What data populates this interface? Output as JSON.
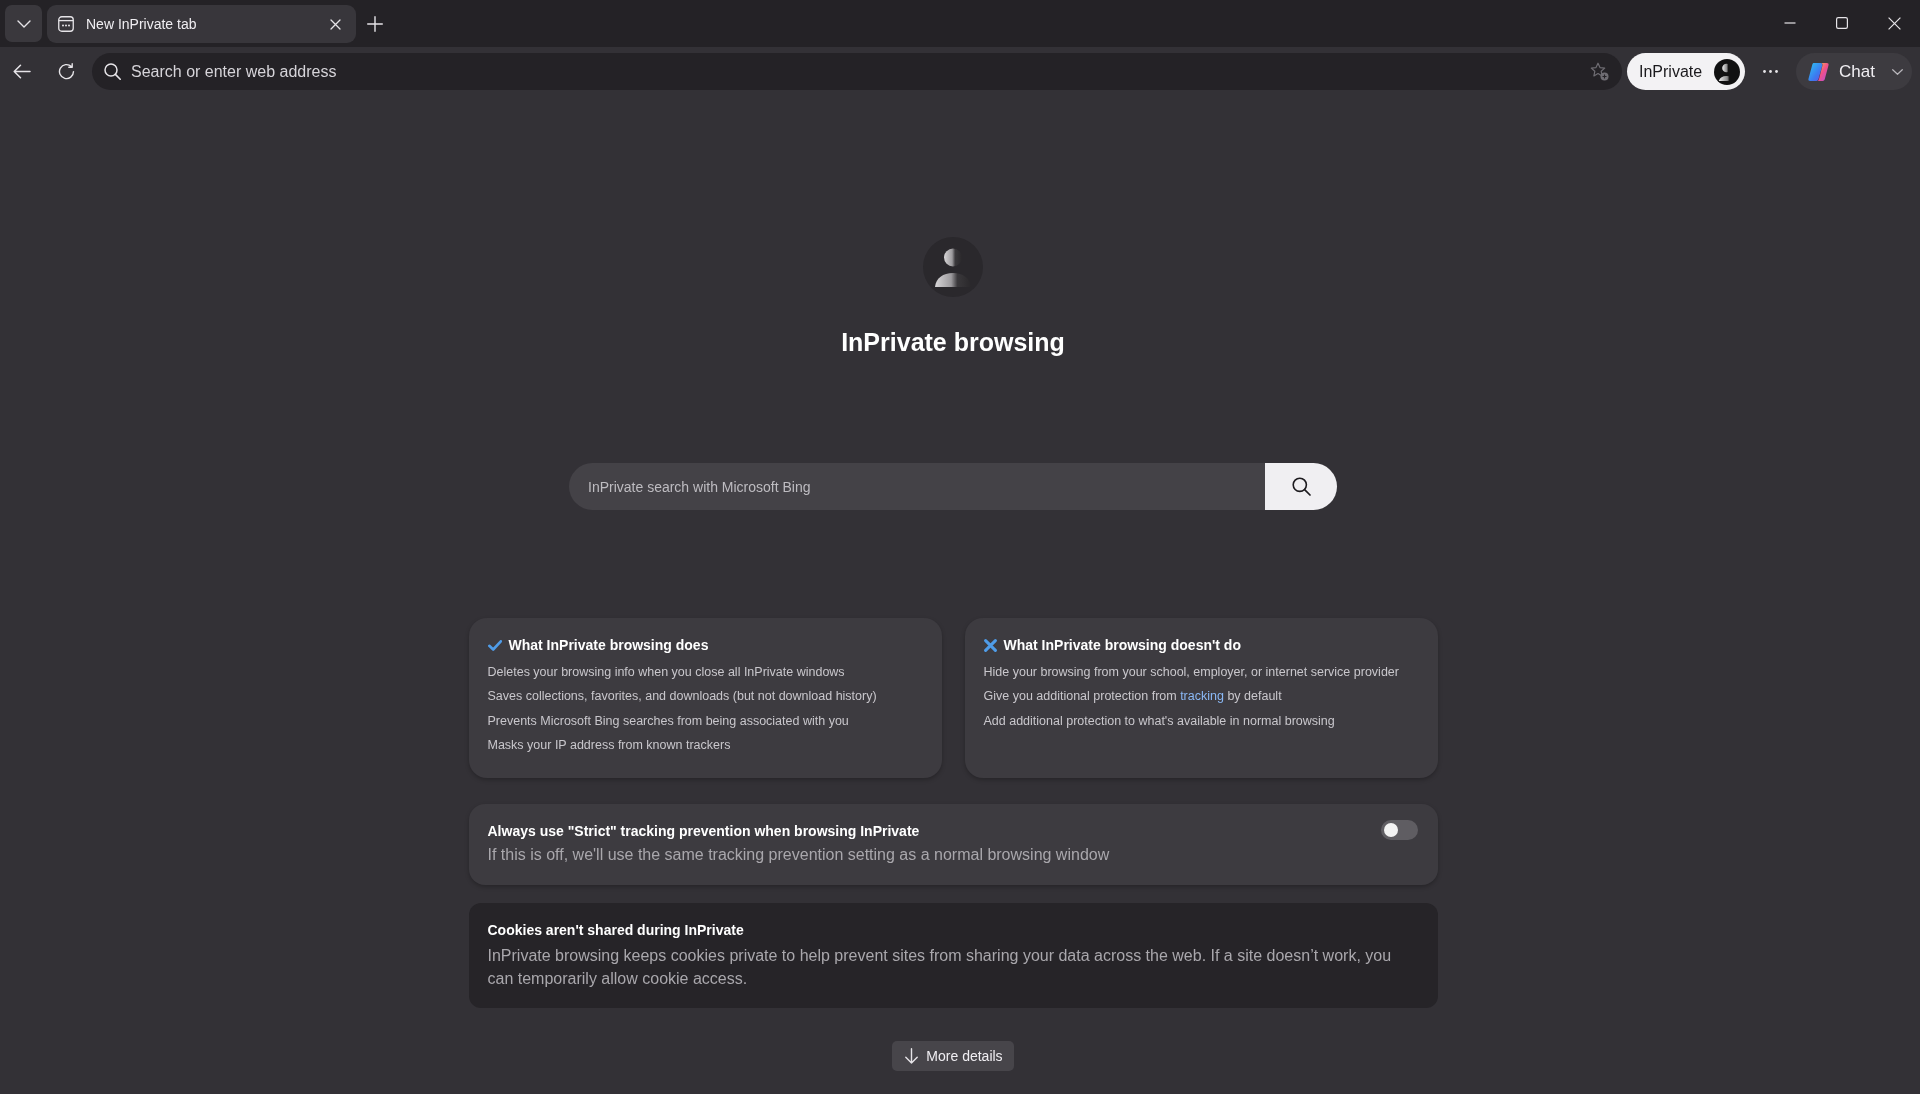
{
  "tab_strip": {
    "tabs": [
      {
        "title": "New InPrivate tab",
        "selected": true
      }
    ]
  },
  "toolbar": {
    "address_bar": {
      "placeholder": "Search or enter web address"
    },
    "profile_button": {
      "label": "InPrivate"
    },
    "chat_button": {
      "label": "Chat"
    }
  },
  "page": {
    "title": "InPrivate browsing",
    "search": {
      "placeholder": "InPrivate search with Microsoft Bing"
    },
    "cards": [
      {
        "kind": "does",
        "title": "What InPrivate browsing does",
        "items": [
          {
            "segments": [
              {
                "kind": "text",
                "text": "Deletes your browsing info when you close all InPrivate windows"
              }
            ]
          },
          {
            "segments": [
              {
                "kind": "text",
                "text": "Saves collections, favorites, and downloads (but not download history)"
              }
            ]
          },
          {
            "segments": [
              {
                "kind": "text",
                "text": "Prevents Microsoft Bing searches from being associated with you"
              }
            ]
          },
          {
            "segments": [
              {
                "kind": "text",
                "text": "Masks your IP address from known trackers"
              }
            ]
          }
        ]
      },
      {
        "kind": "doesnt",
        "title": "What InPrivate browsing doesn't do",
        "items": [
          {
            "segments": [
              {
                "kind": "text",
                "text": "Hide your browsing from your school, employer, or internet service provider"
              }
            ]
          },
          {
            "segments": [
              {
                "kind": "text",
                "text": "Give you additional protection from "
              },
              {
                "kind": "link",
                "text": "tracking"
              },
              {
                "kind": "text",
                "text": " by default"
              }
            ]
          },
          {
            "segments": [
              {
                "kind": "text",
                "text": "Add additional protection to what's available in normal browsing"
              }
            ]
          }
        ]
      }
    ],
    "setting": {
      "title": "Always use \"Strict\" tracking prevention when browsing InPrivate",
      "description": "If this is off, we'll use the same tracking prevention setting as a normal browsing window",
      "on": false
    },
    "notice": {
      "title": "Cookies aren't shared during InPrivate",
      "text": "InPrivate browsing keeps cookies private to help prevent sites from sharing your data across the web. If a site doesn’t work, you can temporarily allow cookie access."
    },
    "more_button": {
      "label": "More details"
    }
  }
}
